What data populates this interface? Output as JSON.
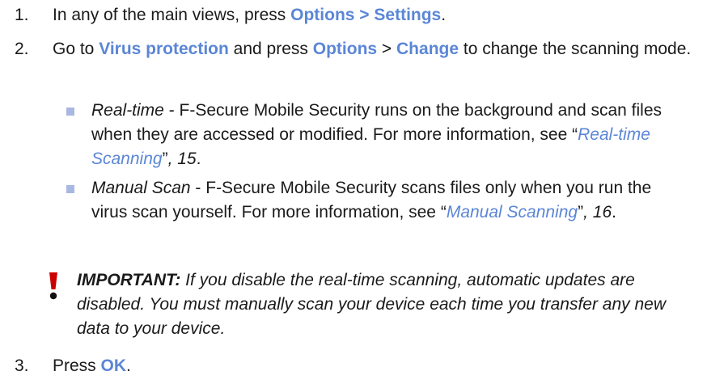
{
  "steps": [
    {
      "num": "1.",
      "text_before": "In any of the main views, press ",
      "ui": "Options > Settings",
      "text_after": "."
    },
    {
      "num": "2.",
      "t1": "Go to ",
      "ui1": "Virus protection",
      "t2": " and press ",
      "ui2": "Options",
      "t3": " > ",
      "ui3": "Change",
      "t4": " to change the scanning mode."
    },
    {
      "num": "3.",
      "text_before": "Press ",
      "ui": "OK",
      "text_after": "."
    }
  ],
  "bullets": [
    {
      "term": "Real-time",
      "desc": " - F-Secure Mobile Security runs on the background and scan files when they are accessed or modified. For more information, see “",
      "link": "Real-time Scanning",
      "close": "”",
      "page_ref": ", 15",
      "end": "."
    },
    {
      "term": "Manual Scan",
      "desc": " - F-Secure Mobile Security scans files only when you run the virus scan yourself. For more information, see “",
      "link": "Manual Scanning",
      "close": "”",
      "page_ref": ", 16",
      "end": "."
    }
  ],
  "note": {
    "label": "IMPORTANT:",
    "text": " If you disable the real-time scanning, automatic updates are disabled. You must manually scan your device each time you transfer any new data to your device."
  },
  "colors": {
    "ui_text": "#5b86d6",
    "bullet_square": "#a9b8e2",
    "warning_icon": "#cc0000"
  },
  "icons": {
    "warning": "exclamation-icon"
  }
}
